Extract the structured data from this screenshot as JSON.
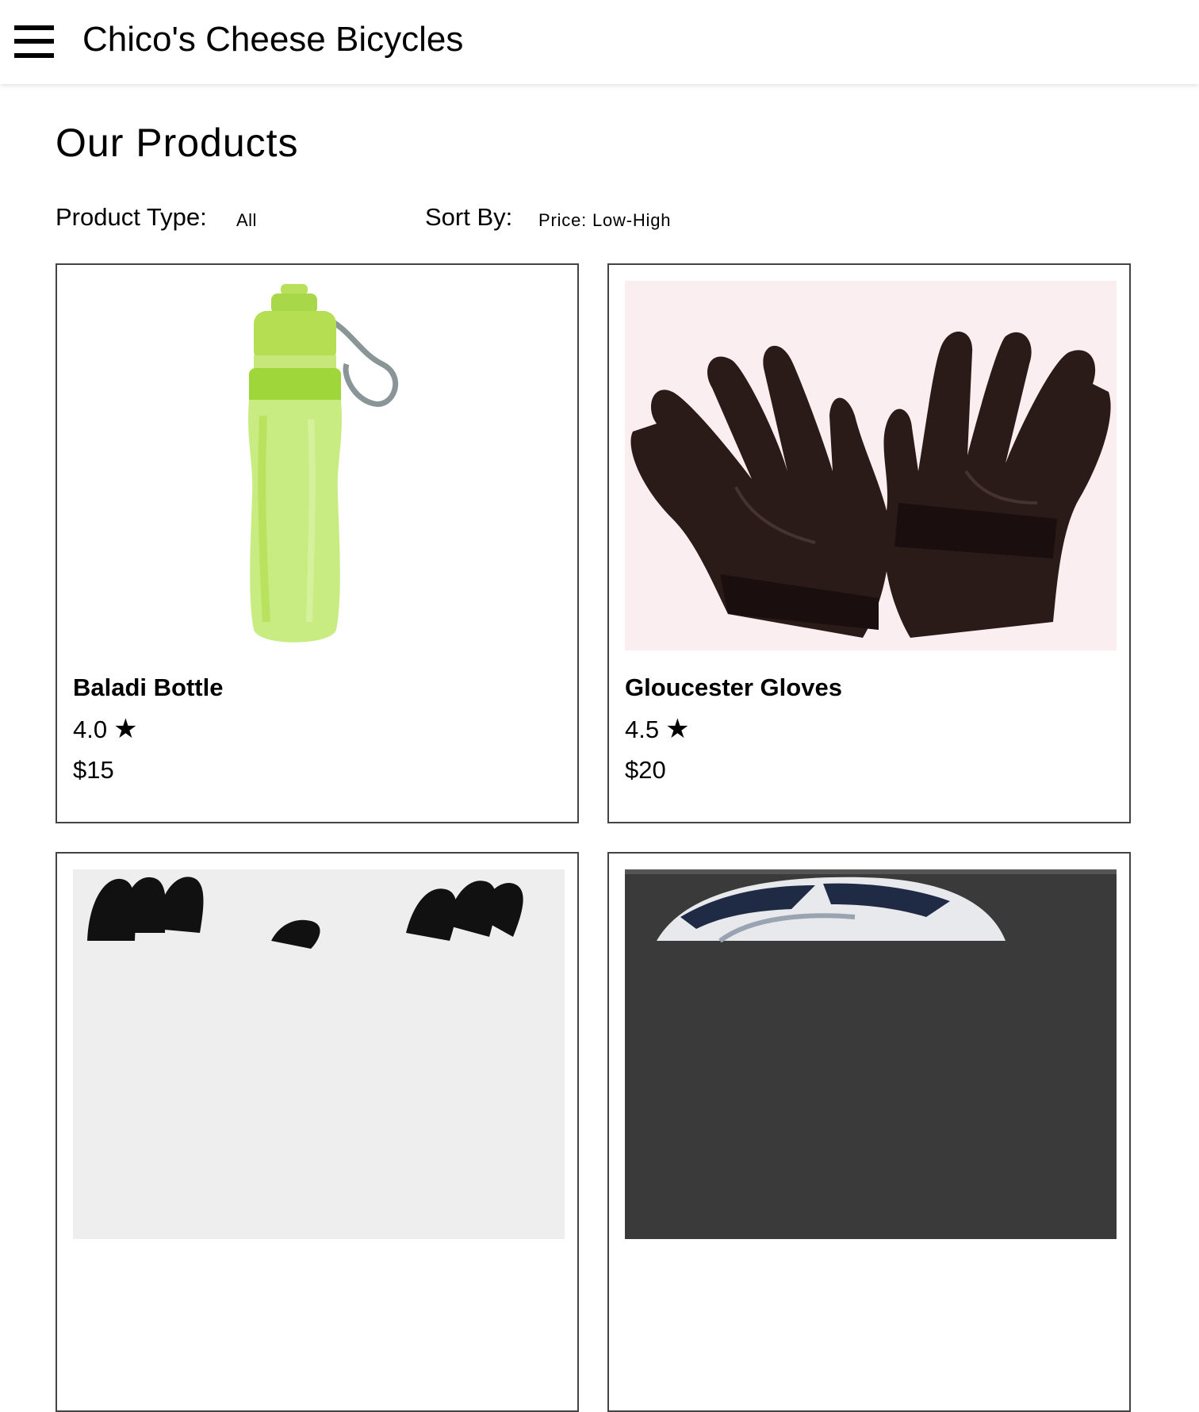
{
  "header": {
    "menu_icon": "hamburger-menu-icon",
    "title": "Chico's Cheese Bicycles"
  },
  "page": {
    "heading": "Our Products"
  },
  "filters": {
    "product_type_label": "Product Type:",
    "product_type_value": "All",
    "sort_by_label": "Sort By:",
    "sort_by_value": "Price: Low-High"
  },
  "products": [
    {
      "name": "Baladi Bottle",
      "rating": "4.0",
      "star_icon": "star-icon",
      "price": "$15",
      "image": "green-water-bottle"
    },
    {
      "name": "Gloucester Gloves",
      "rating": "4.5",
      "star_icon": "star-icon",
      "price": "$20",
      "image": "brown-leather-gloves"
    },
    {
      "image": "black-gloves"
    },
    {
      "image": "bicycle-helmet"
    }
  ],
  "colors": {
    "card_border": "#444444",
    "bottle_green": "#a8dc4a",
    "glove_brown": "#2a1a18",
    "glove_background": "#fbeef0"
  }
}
